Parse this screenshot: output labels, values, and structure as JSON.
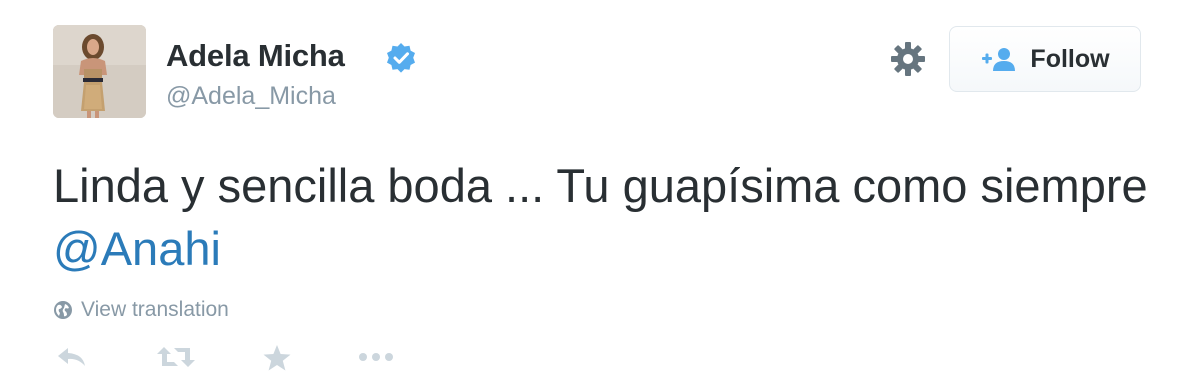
{
  "user": {
    "display_name": "Adela Micha",
    "screen_name": "@Adela_Micha",
    "verified": true
  },
  "header": {
    "settings_icon": "gear-icon",
    "follow_label": "Follow"
  },
  "tweet": {
    "text_part1": "Linda y sencilla boda ... Tu guapísima como siempre ",
    "mention": "@Anahi"
  },
  "translation": {
    "label": "View translation",
    "icon": "globe-icon"
  },
  "actions": [
    {
      "name": "reply",
      "icon": "reply-icon"
    },
    {
      "name": "retweet",
      "icon": "retweet-icon"
    },
    {
      "name": "favorite",
      "icon": "star-icon"
    },
    {
      "name": "more",
      "icon": "more-icon"
    }
  ],
  "colors": {
    "text": "#292f33",
    "secondary": "#8899a6",
    "link": "#2b7bb9",
    "verified": "#55acee",
    "icon": "#ccd6dd"
  }
}
